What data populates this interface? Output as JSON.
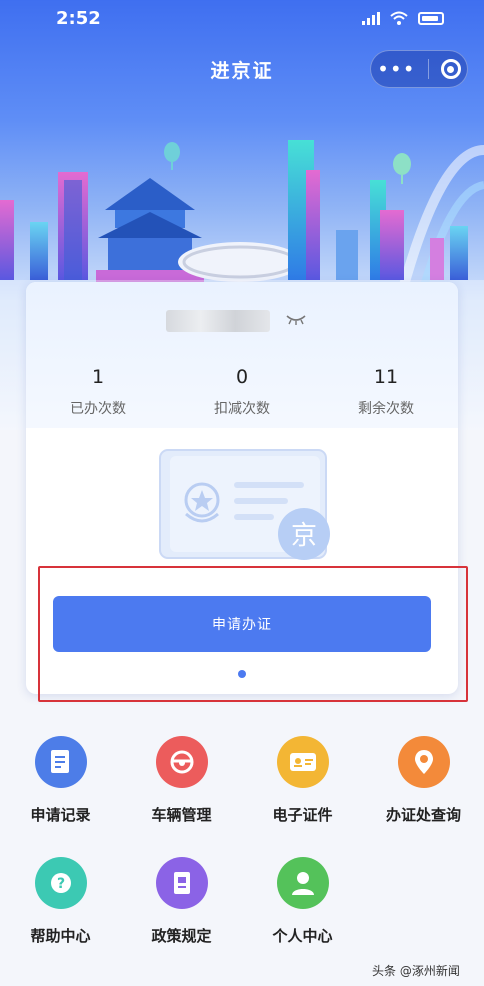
{
  "status_bar": {
    "time": "2:52"
  },
  "nav": {
    "title": "进京证"
  },
  "card": {
    "stats": [
      {
        "value": "1",
        "label": "已办次数"
      },
      {
        "value": "0",
        "label": "扣减次数"
      },
      {
        "value": "11",
        "label": "剩余次数"
      }
    ],
    "badge_text": "京",
    "apply_label": "申请办证"
  },
  "grid": [
    {
      "label": "申请记录",
      "icon": "document-icon",
      "color": "#4d7de8"
    },
    {
      "label": "车辆管理",
      "icon": "steering-wheel-icon",
      "color": "#ec5c5c"
    },
    {
      "label": "电子证件",
      "icon": "id-card-icon",
      "color": "#f3b634"
    },
    {
      "label": "办证处查询",
      "icon": "location-pin-icon",
      "color": "#f38a3a"
    },
    {
      "label": "帮助中心",
      "icon": "help-icon",
      "color": "#3cc9b3"
    },
    {
      "label": "政策规定",
      "icon": "book-icon",
      "color": "#8b63e6"
    },
    {
      "label": "个人中心",
      "icon": "person-icon",
      "color": "#54c25a"
    }
  ],
  "watermark": "头条 @涿州新闻",
  "colors": {
    "primary": "#4c7af0",
    "highlight": "#d7333a"
  }
}
